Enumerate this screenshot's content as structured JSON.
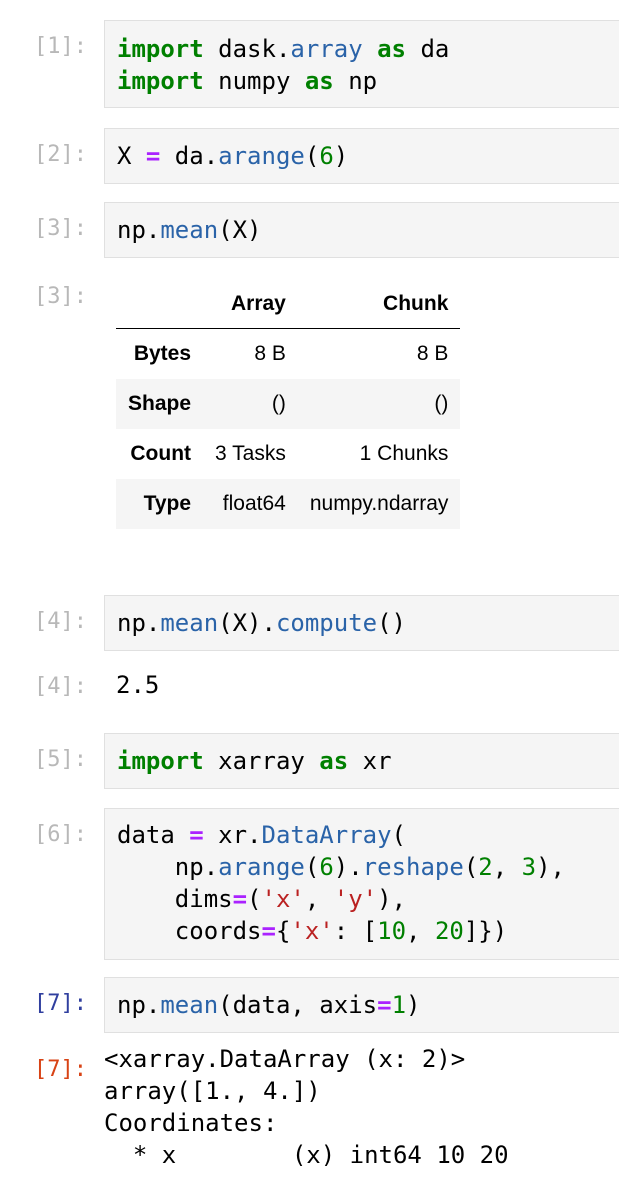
{
  "cells": [
    {
      "prompt": "[1]:",
      "lines": [
        [
          {
            "t": "import",
            "c": "kw"
          },
          {
            "t": " dask.",
            "c": "plain"
          },
          {
            "t": "array",
            "c": "fn"
          },
          {
            "t": " ",
            "c": "plain"
          },
          {
            "t": "as",
            "c": "kw"
          },
          {
            "t": " da",
            "c": "plain"
          }
        ],
        [
          {
            "t": "import",
            "c": "kw"
          },
          {
            "t": " numpy ",
            "c": "plain"
          },
          {
            "t": "as",
            "c": "kw"
          },
          {
            "t": " np",
            "c": "plain"
          }
        ]
      ]
    },
    {
      "prompt": "[2]:",
      "lines": [
        [
          {
            "t": "X ",
            "c": "plain"
          },
          {
            "t": "=",
            "c": "op"
          },
          {
            "t": " da.",
            "c": "plain"
          },
          {
            "t": "arange",
            "c": "fn"
          },
          {
            "t": "(",
            "c": "plain"
          },
          {
            "t": "6",
            "c": "num"
          },
          {
            "t": ")",
            "c": "plain"
          }
        ]
      ]
    },
    {
      "prompt": "[3]:",
      "lines": [
        [
          {
            "t": "np.",
            "c": "plain"
          },
          {
            "t": "mean",
            "c": "fn"
          },
          {
            "t": "(X)",
            "c": "plain"
          }
        ]
      ]
    },
    {
      "prompt": "[4]:",
      "lines": [
        [
          {
            "t": "np.",
            "c": "plain"
          },
          {
            "t": "mean",
            "c": "fn"
          },
          {
            "t": "(X).",
            "c": "plain"
          },
          {
            "t": "compute",
            "c": "fn"
          },
          {
            "t": "()",
            "c": "plain"
          }
        ]
      ]
    },
    {
      "prompt": "[5]:",
      "lines": [
        [
          {
            "t": "import",
            "c": "kw"
          },
          {
            "t": " xarray ",
            "c": "plain"
          },
          {
            "t": "as",
            "c": "kw"
          },
          {
            "t": " xr",
            "c": "plain"
          }
        ]
      ]
    },
    {
      "prompt": "[6]:",
      "lines": [
        [
          {
            "t": "data ",
            "c": "plain"
          },
          {
            "t": "=",
            "c": "op"
          },
          {
            "t": " xr.",
            "c": "plain"
          },
          {
            "t": "DataArray",
            "c": "fn"
          },
          {
            "t": "(",
            "c": "plain"
          }
        ],
        [
          {
            "t": "    np.",
            "c": "plain"
          },
          {
            "t": "arange",
            "c": "fn"
          },
          {
            "t": "(",
            "c": "plain"
          },
          {
            "t": "6",
            "c": "num"
          },
          {
            "t": ").",
            "c": "plain"
          },
          {
            "t": "reshape",
            "c": "fn"
          },
          {
            "t": "(",
            "c": "plain"
          },
          {
            "t": "2",
            "c": "num"
          },
          {
            "t": ", ",
            "c": "plain"
          },
          {
            "t": "3",
            "c": "num"
          },
          {
            "t": "),",
            "c": "plain"
          }
        ],
        [
          {
            "t": "    dims",
            "c": "plain"
          },
          {
            "t": "=",
            "c": "op"
          },
          {
            "t": "(",
            "c": "plain"
          },
          {
            "t": "'x'",
            "c": "str"
          },
          {
            "t": ", ",
            "c": "plain"
          },
          {
            "t": "'y'",
            "c": "str"
          },
          {
            "t": "),",
            "c": "plain"
          }
        ],
        [
          {
            "t": "    coords",
            "c": "plain"
          },
          {
            "t": "=",
            "c": "op"
          },
          {
            "t": "{",
            "c": "plain"
          },
          {
            "t": "'x'",
            "c": "str"
          },
          {
            "t": ": [",
            "c": "plain"
          },
          {
            "t": "10",
            "c": "num"
          },
          {
            "t": ", ",
            "c": "plain"
          },
          {
            "t": "20",
            "c": "num"
          },
          {
            "t": "]})",
            "c": "plain"
          }
        ]
      ]
    },
    {
      "prompt": "[7]:",
      "lines": [
        [
          {
            "t": "np.",
            "c": "plain"
          },
          {
            "t": "mean",
            "c": "fn"
          },
          {
            "t": "(data, axis",
            "c": "plain"
          },
          {
            "t": "=",
            "c": "op"
          },
          {
            "t": "1",
            "c": "num"
          },
          {
            "t": ")",
            "c": "plain"
          }
        ]
      ]
    }
  ],
  "outputs": {
    "out3_prompt": "[3]:",
    "out4_prompt": "[4]:",
    "out4_value": "2.5",
    "out7_prompt": "[7]:",
    "out7_text": "<xarray.DataArray (x: 2)>\narray([1., 4.])\nCoordinates:\n  * x        (x) int64 10 20"
  },
  "table": {
    "headers": [
      "",
      "Array",
      "Chunk"
    ],
    "rows": [
      {
        "label": "Bytes",
        "array": "8 B",
        "chunk": "8 B"
      },
      {
        "label": "Shape",
        "array": "()",
        "chunk": "()"
      },
      {
        "label": "Count",
        "array": "3 Tasks",
        "chunk": "1 Chunks"
      },
      {
        "label": "Type",
        "array": "float64",
        "chunk": "numpy.ndarray"
      }
    ]
  },
  "colors": {
    "keyword": "#008000",
    "function": "#2a63a8",
    "string": "#ba2121",
    "operator": "#aa22ff",
    "prompt": "#b8b8b8",
    "active_in_prompt": "#303f9f",
    "active_out_prompt": "#d84315"
  }
}
